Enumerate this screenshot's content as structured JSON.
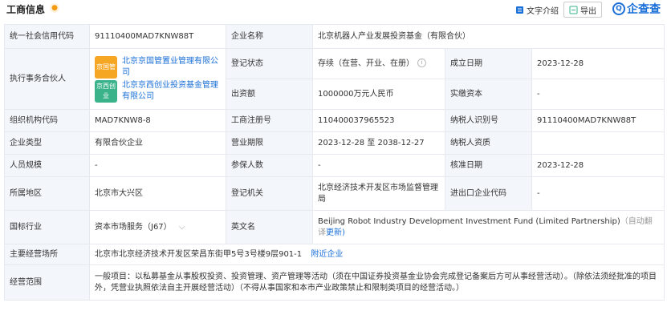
{
  "header": {
    "title": "工商信息",
    "text_intro": "文字介绍",
    "export": "导出",
    "brand": "企查查"
  },
  "colors": {
    "accent": "#1a6fd8",
    "label_bg": "#f3f6fb",
    "badge1": "#f5a623",
    "badge2": "#3ab38b"
  },
  "rows": {
    "credit_code_label": "统一社会信用代码",
    "credit_code": "91110400MAD7KNW88T",
    "company_name_label": "企业名称",
    "company_name": "北京机器人产业发展投资基金（有限合伙）",
    "partner_label": "执行事务合伙人",
    "partners": [
      {
        "badge": "京国管",
        "name": "北京京国管置业管理有限公司"
      },
      {
        "badge": "京西创业",
        "name": "北京京西创业投资基金管理有限公司"
      }
    ],
    "reg_status_label": "登记状态",
    "reg_status": "存续（在营、开业、在册）",
    "founded_label": "成立日期",
    "founded": "2023-12-28",
    "capital_label": "出资额",
    "capital": "1000000万元人民币",
    "paid_label": "实缴资本",
    "paid": "-",
    "org_code_label": "组织机构代码",
    "org_code": "MAD7KNW8-8",
    "reg_no_label": "工商注册号",
    "reg_no": "110400037965523",
    "taxpayer_id_label": "纳税人识别号",
    "taxpayer_id": "91110400MAD7KNW88T",
    "type_label": "企业类型",
    "type": "有限合伙企业",
    "term_label": "营业期限",
    "term": "2023-12-28 至 2038-12-27",
    "taxpayer_q_label": "纳税人资质",
    "taxpayer_q": "",
    "staff_label": "人员规模",
    "staff": "-",
    "insured_label": "参保人数",
    "insured": "-",
    "approve_label": "核准日期",
    "approve": "2023-12-28",
    "region_label": "所属地区",
    "region": "北京市大兴区",
    "authority_label": "登记机关",
    "authority": "北京经济技术开发区市场监督管理局",
    "ie_label": "进出口企业代码",
    "ie": "-",
    "industry_label": "国标行业",
    "industry": "资本市场服务（J67）",
    "en_name_label": "英文名",
    "en_name": "Beijing Robot Industry Development Investment Fund (Limited Partnership)",
    "en_auto": "（自动翻译",
    "en_update": "更新)",
    "address_label": "主要经营场所",
    "address": "北京市北京经济技术开发区荣昌东街甲5号3号楼9层901-1",
    "nearby": "附近企业",
    "scope_label": "经营范围",
    "scope": "一般项目：以私募基金从事股权投资、投资管理、资产管理等活动（须在中国证券投资基金业协会完成登记备案后方可从事经营活动）。（除依法须经批准的项目外，凭营业执照依法自主开展经营活动）（不得从事国家和本市产业政策禁止和限制类项目的经营活动。）"
  }
}
